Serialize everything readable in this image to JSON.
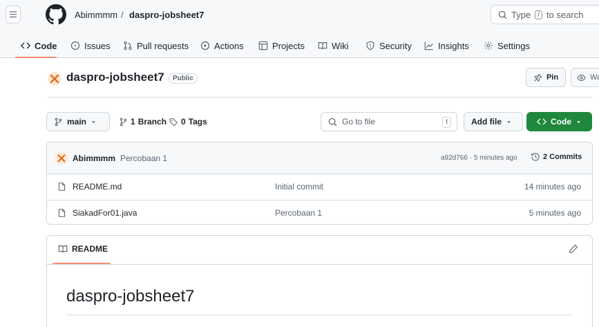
{
  "header": {
    "owner": "Abimmmm",
    "separator": "/",
    "repo": "daspro-jobsheet7",
    "search_prefix": "Type",
    "search_key": "/",
    "search_suffix": "to search"
  },
  "nav": {
    "items": [
      {
        "label": "Code",
        "icon": "code-icon",
        "active": true
      },
      {
        "label": "Issues",
        "icon": "issue-opened-icon"
      },
      {
        "label": "Pull requests",
        "icon": "git-pull-request-icon"
      },
      {
        "label": "Actions",
        "icon": "play-icon"
      },
      {
        "label": "Projects",
        "icon": "table-icon"
      },
      {
        "label": "Wiki",
        "icon": "book-icon"
      },
      {
        "label": "Security",
        "icon": "shield-icon"
      },
      {
        "label": "Insights",
        "icon": "graph-icon"
      },
      {
        "label": "Settings",
        "icon": "gear-icon"
      }
    ],
    "active_color": "#fd8c73"
  },
  "repo": {
    "name": "daspro-jobsheet7",
    "visibility": "Public",
    "pin_label": "Pin",
    "watch_label": "Wa"
  },
  "toolbar": {
    "branch": "main",
    "branch_count": "1",
    "branch_label": "Branch",
    "tag_count": "0",
    "tag_label": "Tags",
    "go_to_file": "Go to file",
    "go_to_file_key": "t",
    "add_file": "Add file",
    "code": "Code",
    "code_color": "#1f883d"
  },
  "commit": {
    "author": "Abimmmm",
    "message": "Percobaan 1",
    "meta": "a92d766 · 5 minutes ago",
    "count_label": "2 Commits"
  },
  "files": [
    {
      "name": "README.md",
      "message": "Initial commit",
      "time": "14 minutes ago",
      "icon": "file-icon"
    },
    {
      "name": "SiakadFor01.java",
      "message": "Percobaan 1",
      "time": "5 minutes ago",
      "icon": "file-icon"
    }
  ],
  "readme": {
    "tab_label": "README",
    "heading": "daspro-jobsheet7"
  }
}
